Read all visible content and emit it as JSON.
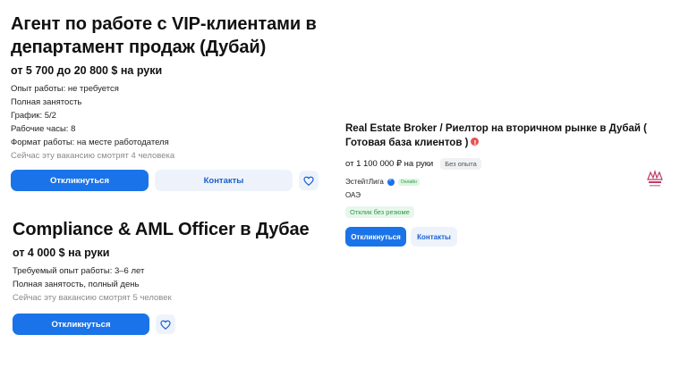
{
  "vacancies": [
    {
      "title": "Агент по работе с VIP-клиентами в департамент продаж (Дубай)",
      "salary": "от 5 700 до 20 800 $ на руки",
      "details": [
        "Опыт работы: не требуется",
        "Полная занятость",
        "График: 5/2",
        "Рабочие часы: 8",
        "Формат работы: на месте работодателя"
      ],
      "viewers": "Сейчас эту вакансию смотрят 4 человека",
      "respond_label": "Откликнуться",
      "contacts_label": "Контакты"
    },
    {
      "title": "Compliance & AML Officer в Дубае",
      "salary": "от 4 000 $ на руки",
      "details": [
        "Требуемый опыт работы: 3–6 лет",
        "Полная занятость, полный день"
      ],
      "viewers": "Сейчас эту вакансию смотрят 5 человек",
      "respond_label": "Откликнуться"
    },
    {
      "title": "Real Estate Broker / Риелтор на вторичном рынке в Дубай ( Готовая база клиентов )",
      "salary": "от 1 100 000 ₽ на руки",
      "experience_chip": "Без опыта",
      "employer": "ЭстейтЛига",
      "online_badge": "Онлайн",
      "location": "ОАЭ",
      "no_resume_tag": "Отклик без резюме",
      "respond_label": "Откликнуться",
      "contacts_label": "Контакты"
    }
  ],
  "colors": {
    "primary": "#1a73e8",
    "secondary_bg": "#eef3fb",
    "alert": "#e55353",
    "success": "#2e9a47"
  }
}
